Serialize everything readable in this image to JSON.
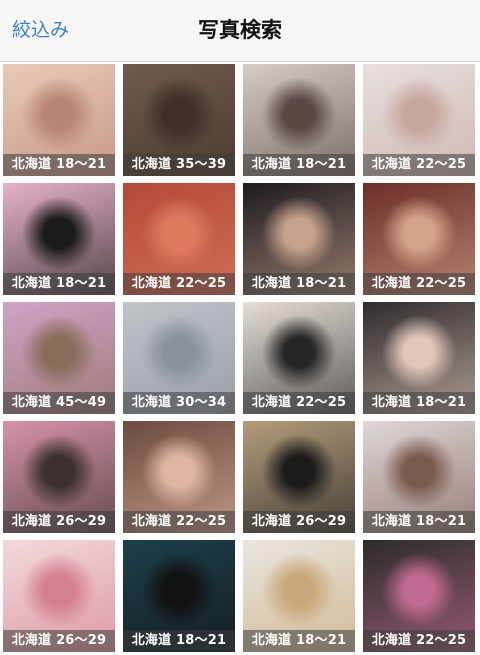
{
  "navbar": {
    "left_label": "絞込み",
    "title": "写真検索"
  },
  "items": [
    {
      "label": "北海道 18〜21",
      "bg": "#e9c9b8",
      "accent": "#b98574"
    },
    {
      "label": "北海道 35〜39",
      "bg": "#6f5a4d",
      "accent": "#3f2f26"
    },
    {
      "label": "北海道 18〜21",
      "bg": "#d7cbc5",
      "accent": "#5a4843"
    },
    {
      "label": "北海道 22〜25",
      "bg": "#e7dfe0",
      "accent": "#c7a79d"
    },
    {
      "label": "北海道 18〜21",
      "bg": "#e7b2c9",
      "accent": "#1a1a1a"
    },
    {
      "label": "北海道 22〜25",
      "bg": "#b24a38",
      "accent": "#e07a5f"
    },
    {
      "label": "北海道 18〜21",
      "bg": "#1e1a1f",
      "accent": "#c6a28c"
    },
    {
      "label": "北海道 22〜25",
      "bg": "#6a2f2a",
      "accent": "#d5a38a"
    },
    {
      "label": "北海道 45〜49",
      "bg": "#cfa3c7",
      "accent": "#8a6b5a"
    },
    {
      "label": "北海道 30〜34",
      "bg": "#bfc4c9",
      "accent": "#8a9198"
    },
    {
      "label": "北海道 22〜25",
      "bg": "#e5ddd6",
      "accent": "#262626"
    },
    {
      "label": "北海道 18〜21",
      "bg": "#2e2b2e",
      "accent": "#e2c7b8"
    },
    {
      "label": "北海道 26〜29",
      "bg": "#d493a7",
      "accent": "#3b2f2f"
    },
    {
      "label": "北海道 22〜25",
      "bg": "#6b4c3e",
      "accent": "#e0b5a3"
    },
    {
      "label": "北海道 26〜29",
      "bg": "#b59c7c",
      "accent": "#1b1b1b"
    },
    {
      "label": "北海道 18〜21",
      "bg": "#e0d6d8",
      "accent": "#7a5b4e"
    },
    {
      "label": "北海道 26〜29",
      "bg": "#f3d9dc",
      "accent": "#d4808c"
    },
    {
      "label": "北海道 18〜21",
      "bg": "#1d3f4d",
      "accent": "#111111"
    },
    {
      "label": "北海道 18〜21",
      "bg": "#eae5df",
      "accent": "#c8a87a"
    },
    {
      "label": "北海道 22〜25",
      "bg": "#2c2c2c",
      "accent": "#c06b8f"
    }
  ]
}
